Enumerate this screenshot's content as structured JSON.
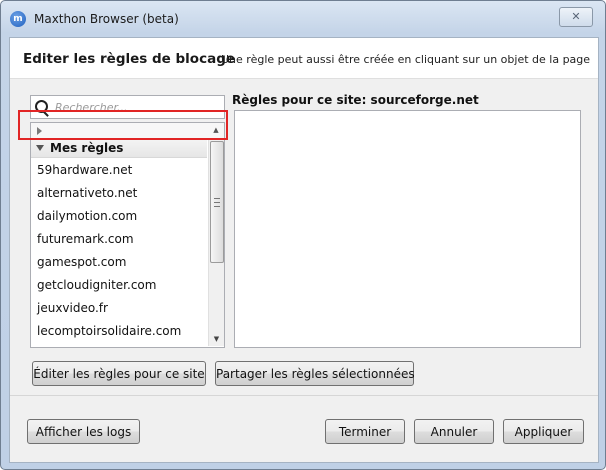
{
  "window": {
    "title": "Maxthon Browser (beta)",
    "app_icon_glyph": "m",
    "close_glyph": "✕"
  },
  "header": {
    "title": "Editer les règles de blocage",
    "subtitle": "Une règle peut aussi être créée en cliquant sur un objet de la page"
  },
  "search": {
    "placeholder": "Rechercher..."
  },
  "list": {
    "group_label": "Mes règles",
    "items": [
      "59hardware.net",
      "alternativeto.net",
      "dailymotion.com",
      "futuremark.com",
      "gamespot.com",
      "getcloudigniter.com",
      "jeuxvideo.fr",
      "lecomptoirsolidaire.com"
    ]
  },
  "rules": {
    "label": "Règles pour ce site: sourceforge.net"
  },
  "buttons": {
    "edit_rules": "Éditer les règles pour ce site",
    "share_rules": "Partager les règles sélectionnées",
    "show_logs": "Afficher les logs",
    "finish": "Terminer",
    "cancel": "Annuler",
    "apply": "Appliquer"
  },
  "colors": {
    "highlight": "#e12525",
    "title_bar": "#c4d4e8"
  }
}
